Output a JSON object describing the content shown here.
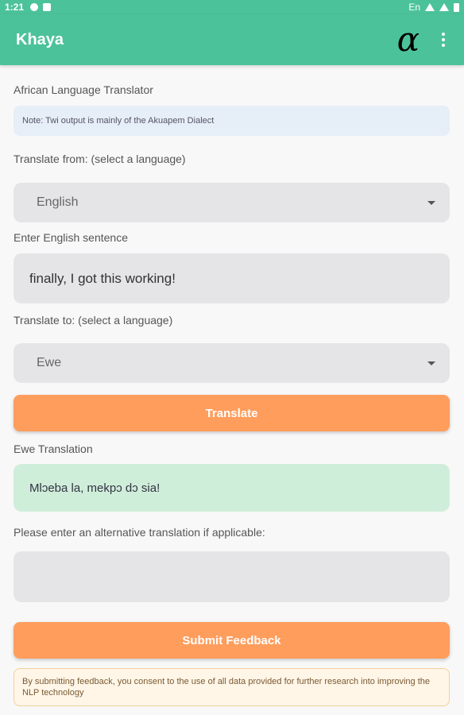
{
  "status_bar": {
    "time": "1:21",
    "lang": "En"
  },
  "app_bar": {
    "title": "Khaya",
    "logo_symbol": "α"
  },
  "main": {
    "heading": "African Language Translator",
    "note": "Note: Twi output is mainly of the Akuapem Dialect",
    "from_label": "Translate from: (select a language)",
    "from_value": "English",
    "input_label": "Enter English sentence",
    "input_value": "finally, I got this working!",
    "to_label": "Translate to: (select a language)",
    "to_value": "Ewe",
    "translate_button": "Translate",
    "result_label": "Ewe Translation",
    "result_value": "Mlɔeba la, mekpɔ dɔ sia!",
    "alt_label": "Please enter an alternative translation if applicable:",
    "alt_value": "",
    "submit_button": "Submit Feedback",
    "consent": "By submitting feedback, you consent to the use of all data provided for further research into improving the NLP technology"
  },
  "colors": {
    "primary": "#4cc29a",
    "accent": "#ff9d5c",
    "result_bg": "#cfeed9",
    "note_bg": "#e6eef8"
  }
}
